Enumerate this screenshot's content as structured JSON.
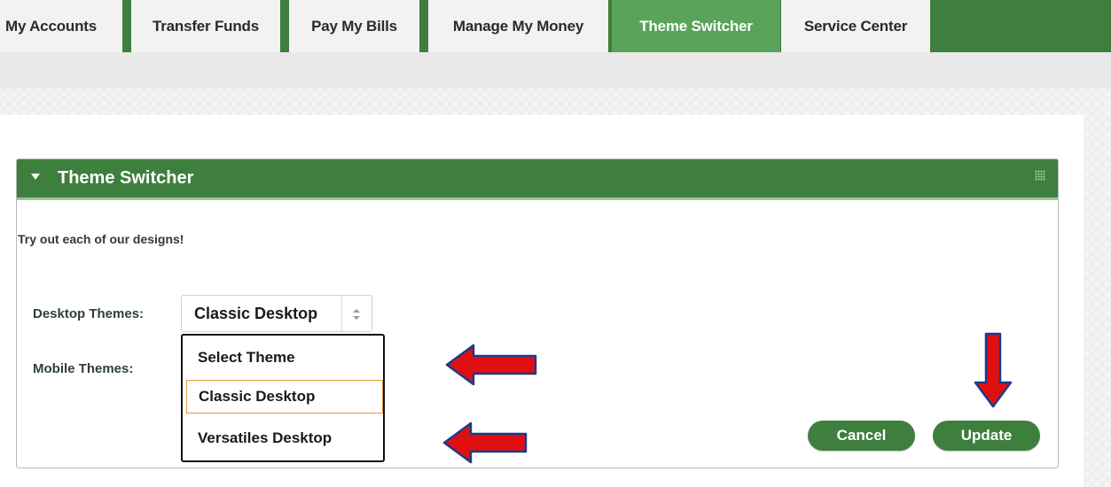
{
  "nav": {
    "tabs": [
      {
        "label": "My Accounts",
        "active": false
      },
      {
        "label": "Transfer Funds",
        "active": false
      },
      {
        "label": "Pay My Bills",
        "active": false
      },
      {
        "label": "Manage My Money",
        "active": false
      },
      {
        "label": "Theme Switcher",
        "active": true
      },
      {
        "label": "Service Center",
        "active": false
      }
    ]
  },
  "panel": {
    "title": "Theme Switcher",
    "intro": "Try out each of our designs!",
    "desktop_label": "Desktop Themes:",
    "mobile_label": "Mobile Themes:",
    "desktop_select": {
      "value": "Classic Desktop",
      "options": [
        "Select Theme",
        "Classic Desktop",
        "Versatiles Desktop"
      ],
      "highlighted_option": "Classic Desktop"
    },
    "buttons": {
      "cancel": "Cancel",
      "update": "Update"
    }
  },
  "colors": {
    "brand_green": "#3e7f3e",
    "active_tab": "#5aa35a",
    "annotation_arrow": "#e01010"
  },
  "icons": [
    "caret-down-icon",
    "grip-icon",
    "select-updown-icon",
    "red-arrow-annotation"
  ]
}
